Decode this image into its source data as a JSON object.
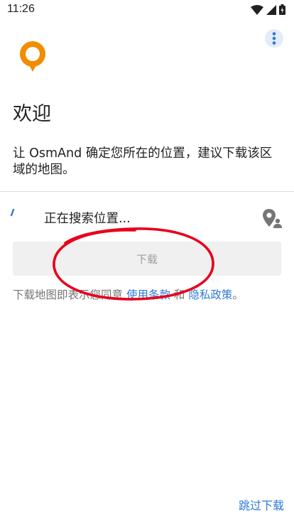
{
  "status_bar": {
    "time": "11:26",
    "icons": [
      "wifi-icon",
      "signal-icon",
      "battery-icon"
    ]
  },
  "header": {
    "logo_icon": "osmand-logo-icon",
    "menu_icon": "more-vert-icon"
  },
  "welcome": {
    "title": "欢迎",
    "text": "让 OsmAnd 确定您所在的位置，建议下载该区域的地图。"
  },
  "location": {
    "status_text": "正在搜索位置...",
    "icon": "location-pin-icon"
  },
  "download_button": {
    "label": "下载"
  },
  "terms": {
    "prefix": "下载地图即表示您同意 ",
    "terms_link": "使用条款",
    "middle": " 和 ",
    "privacy_link": "隐私政策",
    "suffix": "。"
  },
  "skip": {
    "label": "跳过下载"
  },
  "colors": {
    "brand_orange": "#F28C00",
    "accent_blue": "#2F7AD6",
    "annotation_red": "#E8001C"
  }
}
